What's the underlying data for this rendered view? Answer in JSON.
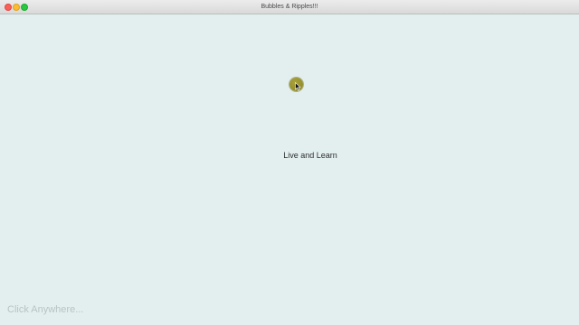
{
  "window": {
    "title": "Bubbles & Ripples!!!"
  },
  "app": {
    "center_text": "Live and Learn",
    "hint_text": "Click Anywhere..."
  },
  "icons": {
    "close": "close-icon",
    "minimize": "minimize-icon",
    "maximize": "maximize-icon",
    "cursor": "mouse-cursor-icon"
  },
  "colors": {
    "background": "#e3efef",
    "bubble": "#9a9430",
    "hint": "#b8c3c3"
  }
}
